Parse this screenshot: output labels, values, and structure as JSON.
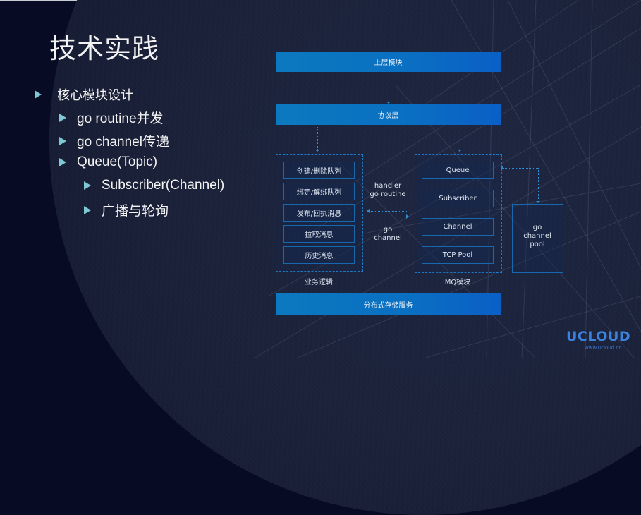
{
  "slide": {
    "title": "技术实践",
    "bullets": [
      {
        "level": 1,
        "text": "核心模块设计"
      },
      {
        "level": 2,
        "text": "go routine并发"
      },
      {
        "level": 2,
        "text": "go channel传递"
      },
      {
        "level": 2,
        "text": "Queue(Topic)"
      },
      {
        "level": 3,
        "text": "Subscriber(Channel)"
      },
      {
        "level": 3,
        "text": "广播与轮询"
      }
    ],
    "bullet_icon": "triangle-right-icon",
    "accent_color": "#7fc7d3"
  },
  "diagram": {
    "top_layer": "上层模块",
    "protocol_layer": "协议层",
    "storage_layer": "分布式存储服务",
    "business_logic": {
      "label": "业务逻辑",
      "items": [
        "创建/删除队列",
        "绑定/解绑队列",
        "发布/回执消息",
        "拉取消息",
        "历史消息"
      ]
    },
    "connector": {
      "top_label_line1": "handler",
      "top_label_line2": "go routine",
      "bottom_label_line1": "go",
      "bottom_label_line2": "channel"
    },
    "mq_module": {
      "label": "MQ模块",
      "items": [
        "Queue",
        "Subscriber",
        "Channel",
        "TCP Pool"
      ]
    },
    "pool": {
      "line1": "go",
      "line2": "channel",
      "line3": "pool"
    },
    "colors": {
      "bar": "#0a6fc2",
      "border": "#1868b0",
      "connector": "#2c8fd6"
    }
  },
  "brand": {
    "logo": "UCLOUD",
    "url": "www.ucloud.cn"
  }
}
